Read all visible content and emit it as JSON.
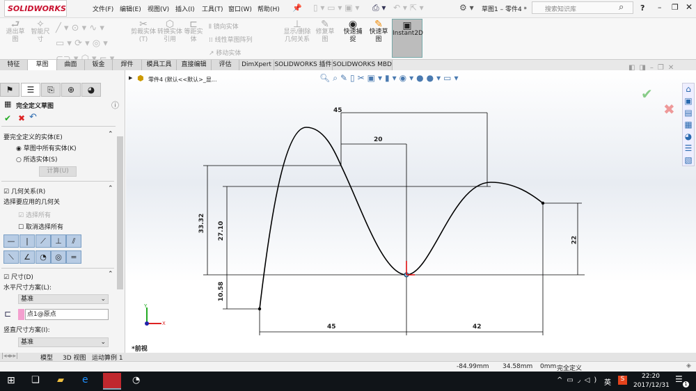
{
  "app": {
    "logo": "SOLIDWORKS",
    "doc_title": "草图1 – 零件4 *",
    "search_placeholder": "搜索知识库",
    "help": "?"
  },
  "menu": [
    "文件(F)",
    "编辑(E)",
    "视图(V)",
    "插入(I)",
    "工具(T)",
    "窗口(W)",
    "帮助(H)"
  ],
  "ribbon": {
    "exit_sketch": "退出草图",
    "smart_dim": "智能尺寸",
    "trim": "剪裁实体(T)",
    "convert": "转换实体引用",
    "offset": "等距实体",
    "mirror": "镜向实体",
    "linear_pattern": "线性草图阵列",
    "move": "移动实体",
    "show_relations": "显示/删除几何关系",
    "repair": "修复草图",
    "quick_snap": "快速捕捉",
    "rapid_sketch": "快速草图",
    "instant2d": "Instant2D"
  },
  "tabs": [
    "特征",
    "草图",
    "曲面",
    "钣金",
    "焊件",
    "模具工具",
    "直接编辑",
    "评估",
    "DimXpert",
    "SOLIDWORKS 插件",
    "SOLIDWORKS MBD"
  ],
  "panel": {
    "title": "完全定义草图",
    "sec1": {
      "title": "要完全定义的实体(E)",
      "opt1": "草图中所有实体(K)",
      "opt2": "所选实体(S)",
      "calc": "计算(U)"
    },
    "sec2": {
      "title": "几何关系(R)",
      "subtitle": "选择要应用的几何关",
      "select_all": "选择所有",
      "deselect_all": "取消选择所有"
    },
    "sec3": {
      "title": "尺寸(D)",
      "h_label": "水平尺寸方案(L):",
      "h_value": "基准",
      "origin": "点1@原点",
      "v_label": "竖直尺寸方案(I):",
      "v_value": "基准"
    }
  },
  "viewport": {
    "tree_item": "零件4  (默认<<默认>_显...",
    "view_name": "*前视",
    "axis_x": "X",
    "axis_y": "Y"
  },
  "dimensions": {
    "top_45": "45",
    "d20": "20",
    "d3332": "33.32",
    "d2710": "27.10",
    "d1058": "10.58",
    "d22": "22",
    "bottom_45": "45",
    "bottom_42": "42"
  },
  "bottom_tabs": [
    "模型",
    "3D 视图",
    "运动算例 1"
  ],
  "status": {
    "x": "-84.99mm",
    "y": "34.58mm",
    "z": "0mm",
    "state": "完全定义"
  },
  "taskbar": {
    "ime": "英",
    "time": "22:20",
    "date": "2017/12/31",
    "notif": "1"
  }
}
